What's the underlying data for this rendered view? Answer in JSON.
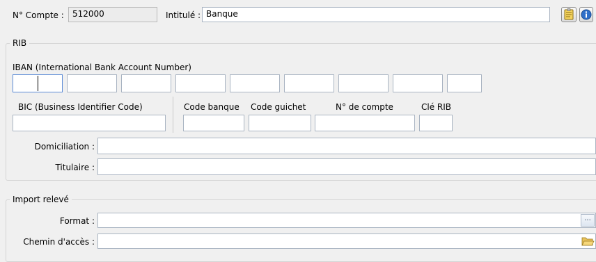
{
  "account": {
    "number_label": "N° Compte :",
    "number_value": "512000",
    "title_label": "Intitulé :",
    "title_value": "Banque"
  },
  "rib": {
    "legend": "RIB",
    "iban_label": "IBAN (International Bank Account Number)",
    "iban_segments": [
      "",
      "",
      "",
      "",
      "",
      "",
      "",
      "",
      ""
    ],
    "bic_label": "BIC (Business Identifier Code)",
    "bic_value": "",
    "code_banque_label": "Code banque",
    "code_banque_value": "",
    "code_guichet_label": "Code guichet",
    "code_guichet_value": "",
    "num_compte_label": "N° de compte",
    "num_compte_value": "",
    "cle_rib_label": "Clé RIB",
    "cle_rib_value": "",
    "domiciliation_label": "Domiciliation :",
    "domiciliation_value": "",
    "titulaire_label": "Titulaire :",
    "titulaire_value": ""
  },
  "import": {
    "legend": "Import relevé",
    "format_label": "Format :",
    "format_value": "",
    "format_button": "...",
    "chemin_label": "Chemin d'accès :",
    "chemin_value": ""
  },
  "icons": {
    "notes": "notepad-icon",
    "info": "info-icon",
    "folder": "open-folder-icon"
  }
}
